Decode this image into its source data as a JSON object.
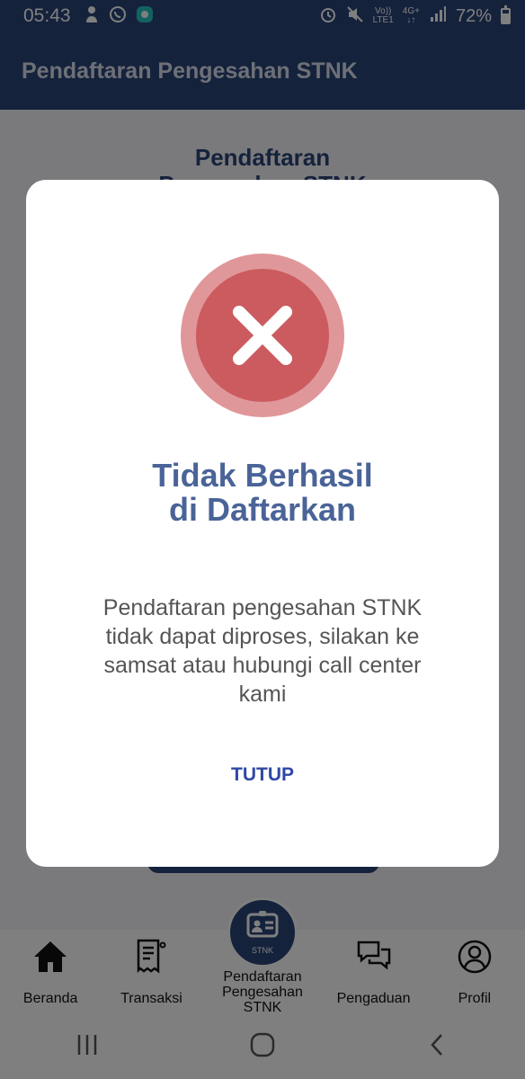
{
  "status_bar": {
    "time": "05:43",
    "network_top": "Vo))",
    "network_bottom": "LTE1",
    "signal_type": "4G+",
    "battery_percent": "72%"
  },
  "app_bar": {
    "title": "Pendaftaran Pengesahan STNK"
  },
  "background_page": {
    "title": "Pendaftaran\nPengesahan STNK"
  },
  "dialog": {
    "icon": "error-x-icon",
    "title_line1": "Tidak Berhasil",
    "title_line2": "di Daftarkan",
    "message_line1": "Pendaftaran pengesahan STNK",
    "message_line2": "tidak dapat diproses, silakan ke",
    "message_line3": "samsat atau hubungi call center",
    "message_line4": "kami",
    "close_label": "TUTUP"
  },
  "bottom_nav": {
    "items": [
      {
        "label": "Beranda",
        "icon": "home-icon"
      },
      {
        "label": "Transaksi",
        "icon": "receipt-icon"
      },
      {
        "label_line1": "Pendaftaran",
        "label_line2": "Pengesahan",
        "label_line3": "STNK",
        "icon": "stnk-card-icon",
        "badge": "STNK"
      },
      {
        "label": "Pengaduan",
        "icon": "chat-icon"
      },
      {
        "label": "Profil",
        "icon": "profile-icon"
      }
    ]
  },
  "colors": {
    "primary": "#2b4478",
    "error_outer": "#e0979a",
    "error_inner": "#cb5b5f",
    "dialog_title": "#4a6498",
    "button_text": "#2f48a4"
  }
}
